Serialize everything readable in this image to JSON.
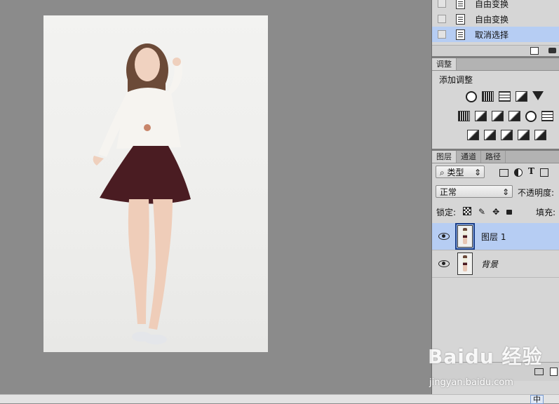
{
  "history": {
    "items": [
      {
        "label": "自由变换"
      },
      {
        "label": "自由变换"
      },
      {
        "label": "取消选择"
      }
    ]
  },
  "adjustments": {
    "tab": "调整",
    "title": "添加调整"
  },
  "layers_panel": {
    "tabs": [
      "图层",
      "通道",
      "路径"
    ],
    "filter_kind": "类型",
    "blend_mode": "正常",
    "opacity_label": "不透明度:",
    "lock_label": "锁定:",
    "fill_label": "填充:",
    "layers": [
      {
        "name": "图层 1",
        "selected": true
      },
      {
        "name": "背景",
        "selected": false
      }
    ]
  },
  "watermark": {
    "brand": "Baidu 经验",
    "url": "jingyan.baidu.com"
  },
  "ime": {
    "label": "中"
  }
}
